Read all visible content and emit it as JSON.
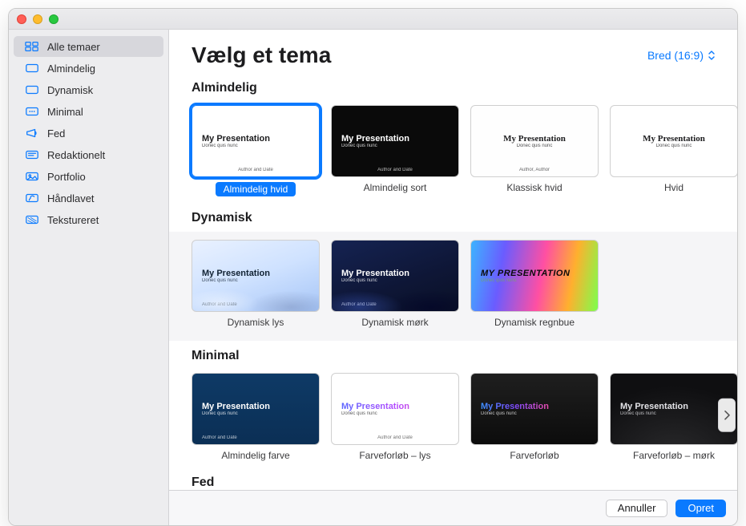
{
  "header": {
    "title": "Vælg et tema",
    "aspect_label": "Bred (16:9)"
  },
  "sidebar": {
    "items": [
      {
        "label": "Alle temaer",
        "icon": "grid"
      },
      {
        "label": "Almindelig",
        "icon": "rect"
      },
      {
        "label": "Dynamisk",
        "icon": "rect"
      },
      {
        "label": "Minimal",
        "icon": "dots"
      },
      {
        "label": "Fed",
        "icon": "megaphone"
      },
      {
        "label": "Redaktionelt",
        "icon": "text"
      },
      {
        "label": "Portfolio",
        "icon": "image"
      },
      {
        "label": "Håndlavet",
        "icon": "brush"
      },
      {
        "label": "Tekstureret",
        "icon": "texture"
      }
    ],
    "selected_index": 0
  },
  "thumb_text": {
    "title_std": "My Presentation",
    "title_upper": "MY PRESENTATION",
    "sub": "Donec quis nunc",
    "foot": "Author and Date",
    "foot_alt": "Author, Author"
  },
  "sections": [
    {
      "title": "Almindelig",
      "shaded": false,
      "themes": [
        {
          "name": "Almindelig hvid",
          "style": "th-white",
          "selected": true,
          "foot": "foot"
        },
        {
          "name": "Almindelig sort",
          "style": "th-black",
          "selected": false,
          "foot": "foot"
        },
        {
          "name": "Klassisk hvid",
          "style": "th-classic",
          "selected": false,
          "foot": "foot_alt"
        },
        {
          "name": "Hvid",
          "style": "th-hvid",
          "selected": false,
          "foot": null
        }
      ],
      "has_peek_right": true,
      "has_nav": false
    },
    {
      "title": "Dynamisk",
      "shaded": true,
      "themes": [
        {
          "name": "Dynamisk lys",
          "style": "th-dynlight",
          "selected": false,
          "foot": "foot",
          "foot_left": true
        },
        {
          "name": "Dynamisk mørk",
          "style": "th-dyndark",
          "selected": false,
          "foot": "foot",
          "foot_left": true
        },
        {
          "name": "Dynamisk regnbue",
          "style": "th-rainbow",
          "selected": false,
          "foot": null,
          "title_key": "title_upper"
        }
      ],
      "has_peek_right": false,
      "has_nav": false
    },
    {
      "title": "Minimal",
      "shaded": false,
      "themes": [
        {
          "name": "Almindelig farve",
          "style": "th-solidcolor",
          "selected": false,
          "foot": "foot",
          "foot_left": true
        },
        {
          "name": "Farveforløb – lys",
          "style": "th-gradlight",
          "selected": false,
          "foot": "foot"
        },
        {
          "name": "Farveforløb",
          "style": "th-grad",
          "selected": false,
          "foot": null
        },
        {
          "name": "Farveforløb – mørk",
          "style": "th-graddark",
          "selected": false,
          "foot": null
        }
      ],
      "has_peek_right": true,
      "has_nav": true
    },
    {
      "title": "Fed",
      "shaded": true,
      "themes": [],
      "has_peek_right": false,
      "has_nav": false
    }
  ],
  "footer": {
    "cancel": "Annuller",
    "create": "Opret"
  }
}
